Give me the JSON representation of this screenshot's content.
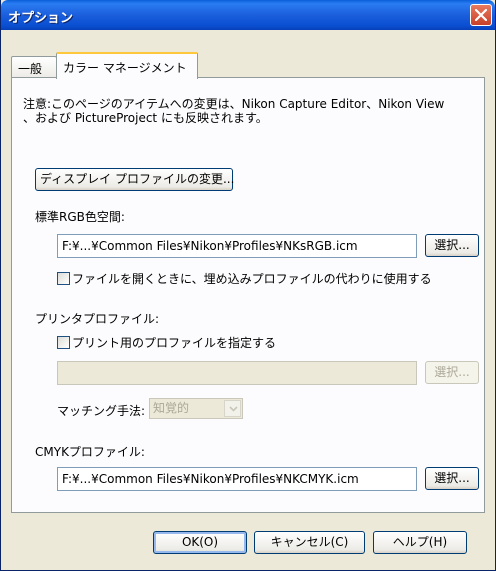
{
  "window": {
    "title": "オプション"
  },
  "tabs": [
    {
      "label": "一般"
    },
    {
      "label": "カラー マネージメント"
    }
  ],
  "notice": {
    "line1": "注意:このページのアイテムへの変更は、Nikon Capture Editor、Nikon View",
    "line2": "、および PictureProject にも反映されます。"
  },
  "display_profile_button": "ディスプレイ プロファイルの変更...",
  "rgb": {
    "label": "標準RGB色空間:",
    "path": "F:¥...¥Common Files¥Nikon¥Profiles¥NKsRGB.icm",
    "select_button": "選択...",
    "checkbox_label": "ファイルを開くときに、埋め込みプロファイルの代わりに使用する"
  },
  "printer": {
    "label": "プリンタプロファイル:",
    "checkbox_label": "プリント用のプロファイルを指定する",
    "path": "",
    "select_button": "選択...",
    "matching_label": "マッチング手法:",
    "matching_value": "知覚的"
  },
  "cmyk": {
    "label": "CMYKプロファイル:",
    "path": "F:¥...¥Common Files¥Nikon¥Profiles¥NKCMYK.icm",
    "select_button": "選択..."
  },
  "footer": {
    "ok": "OK(O)",
    "cancel": "キャンセル(C)",
    "help": "ヘルプ(H)"
  }
}
